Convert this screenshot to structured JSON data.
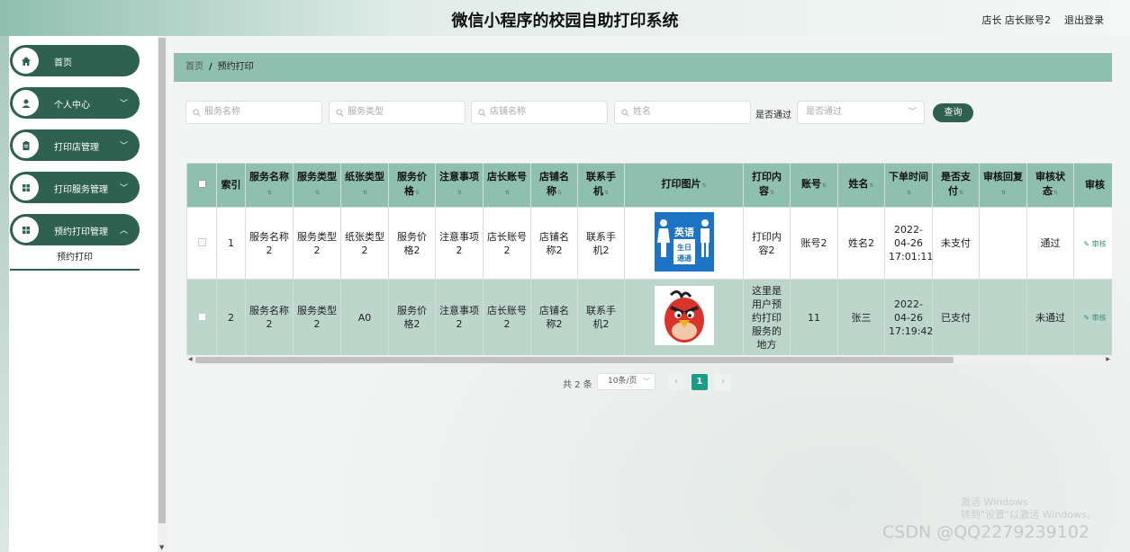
{
  "header": {
    "title": "微信小程序的校园自助打印系统",
    "user": "店长 店长账号2",
    "logout": "退出登录"
  },
  "sidebar": {
    "items": [
      {
        "label": "首页",
        "icon": "home-icon"
      },
      {
        "label": "个人中心",
        "icon": "user-icon"
      },
      {
        "label": "打印店管理",
        "icon": "clipboard-icon"
      },
      {
        "label": "打印服务管理",
        "icon": "grid-icon"
      },
      {
        "label": "预约打印管理",
        "icon": "grid-icon"
      }
    ],
    "subitem": "预约打印"
  },
  "breadcrumb": {
    "home": "首页",
    "separator": "/",
    "current": "预约打印"
  },
  "search": {
    "service_name": "服务名称",
    "service_type": "服务类型",
    "shop_name": "店铺名称",
    "name": "姓名",
    "approved_label": "是否通过",
    "approved_placeholder": "是否通过",
    "query_button": "查询"
  },
  "table": {
    "headers": [
      "索引",
      "服务名称",
      "服务类型",
      "纸张类型",
      "服务价格",
      "注意事项",
      "店长账号",
      "店铺名称",
      "联系手机",
      "打印图片",
      "打印内容",
      "账号",
      "姓名",
      "下单时间",
      "是否支付",
      "审核回复",
      "审核状态",
      "审核"
    ],
    "rows": [
      {
        "index": "1",
        "service_name": "服务名称2",
        "service_type": "服务类型2",
        "paper_type": "纸张类型2",
        "price": "服务价格2",
        "notes": "注意事项2",
        "manager_account": "店长账号2",
        "shop_name": "店铺名称2",
        "phone": "联系手机2",
        "image_text": "英语 生日 通通",
        "content": "打印内容2",
        "account": "账号2",
        "name": "姓名2",
        "order_time": "2022-04-26 17:01:11",
        "paid": "未支付",
        "reply": "",
        "status": "通过",
        "action": "审核"
      },
      {
        "index": "2",
        "service_name": "服务名称2",
        "service_type": "服务类型2",
        "paper_type": "A0",
        "price": "服务价格2",
        "notes": "注意事项2",
        "manager_account": "店长账号2",
        "shop_name": "店铺名称2",
        "phone": "联系手机2",
        "image_text": "",
        "content": "这里是用户预约打印服务的地方",
        "account": "11",
        "name": "张三",
        "order_time": "2022-04-26 17:19:42",
        "paid": "已支付",
        "reply": "",
        "status": "未通过",
        "action": "审核"
      }
    ]
  },
  "pagination": {
    "total": "共 2 条",
    "page_size": "10条/页",
    "current": "1",
    "prev": "‹",
    "next": "›"
  },
  "watermarks": {
    "windows_line1": "激活 Windows",
    "windows_line2": "转到\"设置\"以激活 Windows。",
    "csdn": "CSDN @QQ2279239102"
  },
  "colors": {
    "primary": "#2e6150",
    "header_teal": "#8fbfae",
    "accent": "#1b9c85",
    "row_alt": "#bcd6cc"
  }
}
